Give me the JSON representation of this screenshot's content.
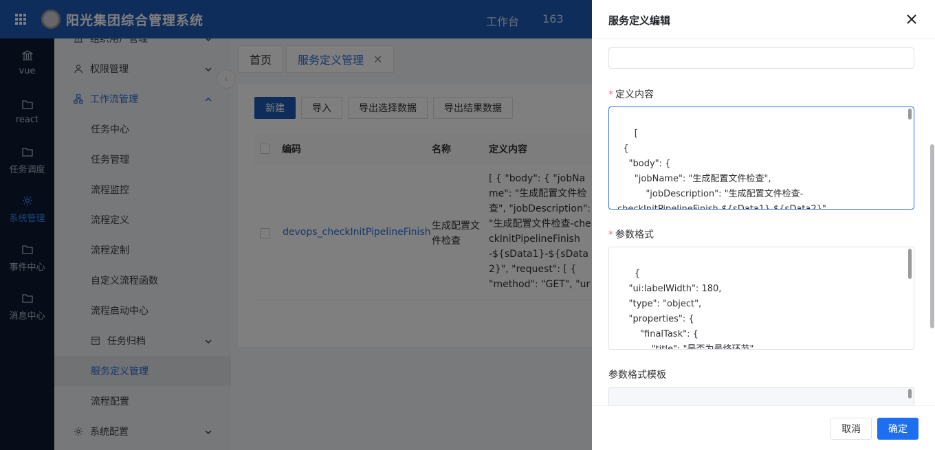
{
  "header": {
    "app_title": "阳光集团综合管理系统",
    "nav": [
      "工作台",
      "163"
    ]
  },
  "leftbar": [
    {
      "label": "vue",
      "icon": "bank-icon"
    },
    {
      "label": "react",
      "icon": "folder-icon"
    },
    {
      "label": "任务调度",
      "icon": "folder-icon"
    },
    {
      "label": "系统管理",
      "icon": "gear-icon",
      "active": true
    },
    {
      "label": "事件中心",
      "icon": "folder-icon"
    },
    {
      "label": "消息中心",
      "icon": "folder-icon"
    }
  ],
  "submenu": {
    "items": [
      {
        "label": "组织用户管理",
        "type": "group"
      },
      {
        "label": "权限管理",
        "type": "group"
      },
      {
        "label": "工作流管理",
        "type": "group",
        "expanded": true
      },
      {
        "label": "任务中心",
        "type": "sub"
      },
      {
        "label": "任务管理",
        "type": "sub"
      },
      {
        "label": "流程监控",
        "type": "sub"
      },
      {
        "label": "流程定义",
        "type": "sub"
      },
      {
        "label": "流程定制",
        "type": "sub"
      },
      {
        "label": "自定义流程函数",
        "type": "sub"
      },
      {
        "label": "流程启动中心",
        "type": "sub"
      },
      {
        "label": "任务归档",
        "type": "subgroup"
      },
      {
        "label": "服务定义管理",
        "type": "sub",
        "active": true
      },
      {
        "label": "流程配置",
        "type": "sub"
      },
      {
        "label": "系统配置",
        "type": "group"
      }
    ]
  },
  "tabs": [
    {
      "label": "首页"
    },
    {
      "label": "服务定义管理",
      "active": true
    }
  ],
  "toolbar": {
    "new": "新建",
    "import": "导入",
    "export_selected": "导出选择数据",
    "export_result": "导出结果数据"
  },
  "table": {
    "columns": [
      "编码",
      "名称",
      "定义内容"
    ],
    "rows": [
      {
        "code": "devops_checkInitPipelineFinish",
        "name": "生成配置文件检查",
        "definition": "[ { \"body\": { \"jobName\": \"生成配置文件检查\", \"jobDescription\": \"生成配置文件检查-checkInitPipelineFinish-${sData1}-${sData2}\", \"request\": [ { \"method\": \"GET\", \"url\": \"..."
      }
    ]
  },
  "drawer": {
    "title": "服务定义编辑",
    "definition_label": "定义内容",
    "definition_value": "[\n  {\n    \"body\": {\n      \"jobName\": \"生成配置文件检查\",\n          \"jobDescription\": \"生成配置文件检查-\ncheckInitPipelineFinish-${sData1}-${sData2}\",\n      \"request\": [",
    "params_label": "参数格式",
    "params_value": "{\n    \"ui:labelWidth\": 180,\n    \"type\": \"object\",\n    \"properties\": {\n        \"finalTask\": {\n            \"title\": \"是否为最终环节\",\n                \"type\": \"boolean\"",
    "template_label": "参数格式模板",
    "template_value": "{",
    "cancel": "取消",
    "confirm": "确定"
  },
  "colors": {
    "header": "#1e5bb5",
    "sidebar": "#0c1b31",
    "accent": "#2a6ed8",
    "primary_button": "#1e6ff0"
  }
}
